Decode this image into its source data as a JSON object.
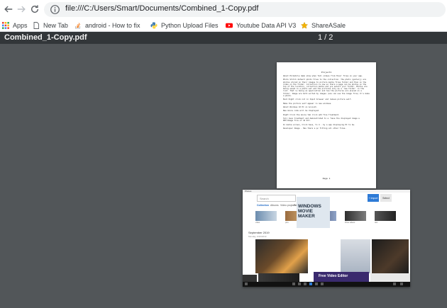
{
  "browser": {
    "back_icon": "arrow-left-icon",
    "forward_icon": "arrow-right-icon",
    "reload_icon": "reload-icon",
    "info_icon": "info-icon",
    "url": "file:///C:/Users/Smart/Documents/Combined_1-Copy.pdf"
  },
  "bookmarks": [
    {
      "label": "Apps",
      "icon": "apps-grid-icon"
    },
    {
      "label": "New Tab",
      "icon": "page-icon"
    },
    {
      "label": "android - How to fix",
      "icon": "stackoverflow-icon"
    },
    {
      "label": "Python Upload Files",
      "icon": "python-icon"
    },
    {
      "label": "Youtube Data API V3",
      "icon": "youtube-icon"
    },
    {
      "label": "ShareASale",
      "icon": "star-icon"
    }
  ],
  "pdf": {
    "title": "Combined_1-Copy.pdf",
    "page_indicator": "1 / 2"
  },
  "page1": {
    "heading": "Project1",
    "paragraphs": [
      "About PC/mobile demo show when fall videos from their files on your app.",
      "Photo Stitch default photo files to the collection. The photo (gallery) are photos stored on their images to picture media files folder and then on the video on the folder. Collection is new so there a page can be photos on the top of the location, collection media and you select your folder. Photos are being saved in a photo set and the pictures only as a 'new folder' in the list. That is being an application and how the pictures are placed on a folder. Image are both sorted by images (one can use the image file) it's make a photo.",
      "Each Right click not in Input browser and remove picture self.",
      "Make the picture self appear in new windows.",
      "About Windows 10 PC on Account.",
      "New movie code will be displayed.",
      "Right Click the movie tab click add fine Treatment.",
      "Tell have treatment and demonstrated to a 'Save the displayed image a PDF/Image file of 10 Pct.",
      "In media screen, Click Save, to 4 - by a app displaying PC to be.",
      "Developer Image - Has there a pc fitting all other files."
    ],
    "page_label": "Page 1"
  },
  "page2": {
    "window_title": "Photos",
    "search_placeholder": "Search",
    "buttons": [
      "+ Import",
      "Select"
    ],
    "tabs": [
      "Collection",
      "Albums",
      "Video projects",
      "People",
      "Folders"
    ],
    "active_tab": "Collection",
    "strip_captions": [
      "video",
      "pics",
      "Favourites",
      "Drive videos",
      "test"
    ],
    "section_title": "September 2019",
    "section_sub": "Monday, 9/16/2019",
    "wmm_title": "WINDOWS MOVIE MAKER",
    "free_video": "Free Video Editor"
  }
}
